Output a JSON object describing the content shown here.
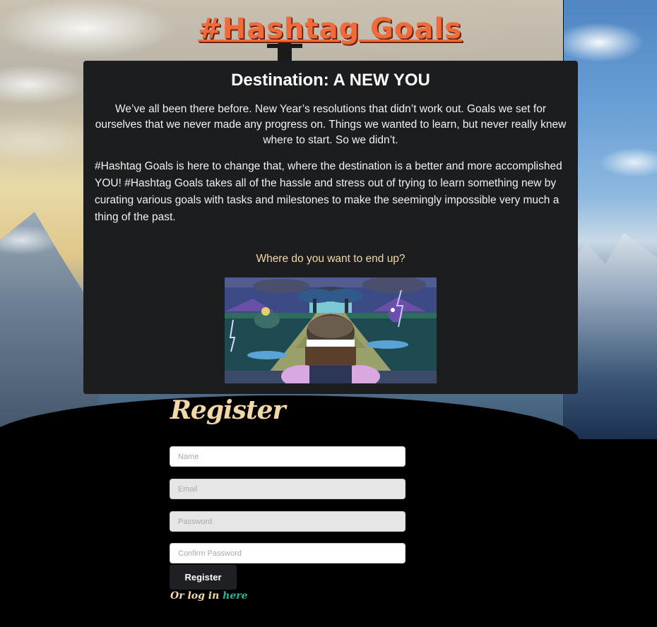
{
  "header": {
    "title": "#Hashtag Goals"
  },
  "card": {
    "heading": "Destination: A NEW YOU",
    "intro": "We’ve all been there before. New Year’s resolutions that didn’t work out. Goals we set for ourselves that we never made any progress on. Things we wanted to learn, but never really knew where to start. So we didn’t.",
    "body": "#Hashtag Goals is here to change that, where the destination is a better and more accomplished YOU! #Hashtag Goals takes all of the hassle and stress out of trying to learn something new by curating various goals with tasks and milestones to make the seemingly impossible very much a thing of the past.",
    "question": "Where do you want to end up?"
  },
  "register": {
    "heading": "Register",
    "name_placeholder": "Name",
    "email_placeholder": "Email",
    "password_placeholder": "Password",
    "confirm_placeholder": "Confirm Password",
    "button_label": "Register",
    "login_prefix": "Or log in ",
    "login_link": "here"
  },
  "colors": {
    "title": "#f06a3b",
    "accent_text": "#f4d7a6",
    "link": "#2bb39a",
    "card_bg": "#1c1d1f"
  }
}
